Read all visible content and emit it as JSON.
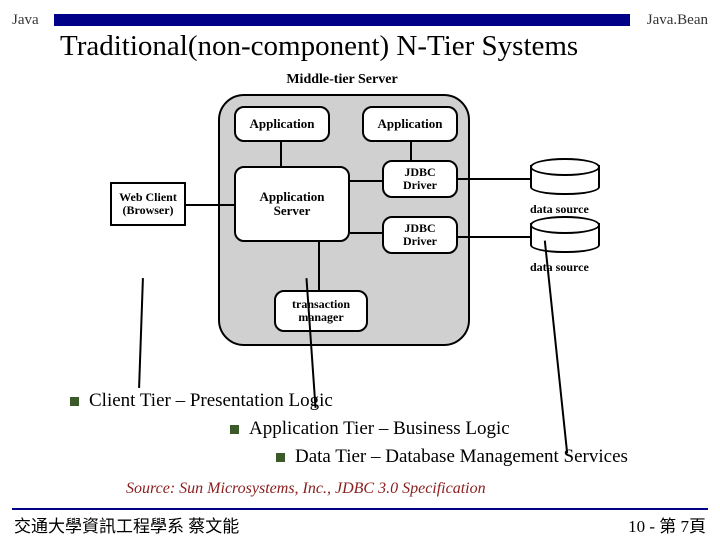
{
  "header": {
    "left": "Java",
    "right": "Java.Bean"
  },
  "title": "Traditional(non-component)  N-Tier Systems",
  "diagram": {
    "middle_tier_title": "Middle-tier Server",
    "web_client_line1": "Web Client",
    "web_client_line2": "(Browser)",
    "application1": "Application",
    "application2": "Application",
    "app_server_line1": "Application",
    "app_server_line2": "Server",
    "jdbc1_line1": "JDBC",
    "jdbc1_line2": "Driver",
    "jdbc2_line1": "JDBC",
    "jdbc2_line2": "Driver",
    "txn_line1": "transaction",
    "txn_line2": "manager",
    "data_source1": "data source",
    "data_source2": "data source"
  },
  "bullets": {
    "client": "Client Tier – Presentation Logic",
    "app": "Application Tier – Business Logic",
    "data": "Data Tier – Database Management Services"
  },
  "source_note": "Source: Sun Microsystems, Inc., JDBC 3.0 Specification",
  "footer": {
    "left": "交通大學資訊工程學系 蔡文能",
    "right": "10 - 第 7頁"
  }
}
